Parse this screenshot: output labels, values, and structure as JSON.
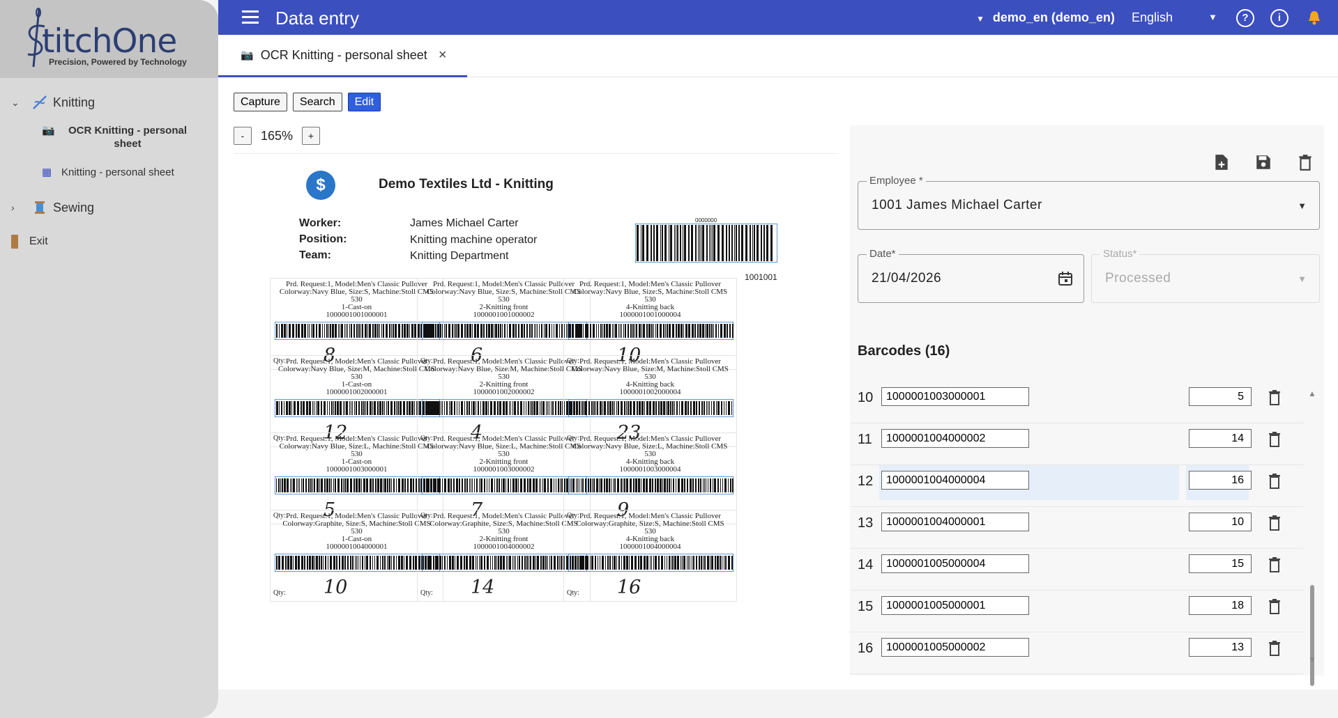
{
  "sidebar": {
    "logo_text": "titchOne",
    "logo_tag": "Precision, Powered by Technology",
    "groups": [
      {
        "label": "Knitting",
        "items": [
          {
            "label": "OCR Knitting - personal sheet"
          },
          {
            "label": "Knitting - personal sheet"
          }
        ]
      },
      {
        "label": "Sewing"
      }
    ],
    "exit_label": "Exit"
  },
  "header": {
    "title": "Data entry",
    "tenant": "demo_en (demo_en)",
    "language": "English",
    "help_glyph": "?",
    "info_glyph": "i"
  },
  "tab": {
    "label": "OCR Knitting - personal sheet",
    "close": "×"
  },
  "toolbar": {
    "capture": "Capture",
    "search": "Search",
    "edit": "Edit"
  },
  "zoom": {
    "minus": "-",
    "value": "165%",
    "plus": "+"
  },
  "document": {
    "title": "Demo Textiles Ltd - Knitting",
    "worker_label": "Worker:",
    "worker": "James Michael Carter",
    "position_label": "Position:",
    "position": "Knitting machine operator",
    "team_label": "Team:",
    "team": "Knitting Department",
    "barcode_number": "1001001",
    "barcode_top": "0000000",
    "qty_label": "Qty:",
    "cells": [
      {
        "l1": "Prd. Request:1, Model:Men's Classic Pullover",
        "l2": "Colorway:Navy Blue, Size:S, Machine:Stoll CMS",
        "l3": "530",
        "l4": "1-Cast-on",
        "l5": "1000001001000001",
        "qty": "8"
      },
      {
        "l1": "Prd. Request:1, Model:Men's Classic Pullover",
        "l2": "Colorway:Navy Blue, Size:S, Machine:Stoll CMS",
        "l3": "530",
        "l4": "2-Knitting front",
        "l5": "1000001001000002",
        "qty": "6"
      },
      {
        "l1": "Prd. Request:1, Model:Men's Classic Pullover",
        "l2": "Colorway:Navy Blue, Size:S, Machine:Stoll CMS",
        "l3": "530",
        "l4": "4-Knitting back",
        "l5": "1000001001000004",
        "qty": "10"
      },
      {
        "l1": "Prd. Request:1, Model:Men's Classic Pullover",
        "l2": "Colorway:Navy Blue, Size:M, Machine:Stoll CMS",
        "l3": "530",
        "l4": "1-Cast-on",
        "l5": "1000001002000001",
        "qty": "12"
      },
      {
        "l1": "Prd. Request:1, Model:Men's Classic Pullover",
        "l2": "Colorway:Navy Blue, Size:M, Machine:Stoll CMS",
        "l3": "530",
        "l4": "2-Knitting front",
        "l5": "1000001002000002",
        "qty": "4"
      },
      {
        "l1": "Prd. Request:1, Model:Men's Classic Pullover",
        "l2": "Colorway:Navy Blue, Size:M, Machine:Stoll CMS",
        "l3": "530",
        "l4": "4-Knitting back",
        "l5": "1000001002000004",
        "qty": "23"
      },
      {
        "l1": "Prd. Request:1, Model:Men's Classic Pullover",
        "l2": "Colorway:Navy Blue, Size:L, Machine:Stoll CMS",
        "l3": "530",
        "l4": "1-Cast-on",
        "l5": "1000001003000001",
        "qty": "5"
      },
      {
        "l1": "Prd. Request:1, Model:Men's Classic Pullover",
        "l2": "Colorway:Navy Blue, Size:L, Machine:Stoll CMS",
        "l3": "530",
        "l4": "2-Knitting front",
        "l5": "1000001003000002",
        "qty": "7"
      },
      {
        "l1": "Prd. Request:1, Model:Men's Classic Pullover",
        "l2": "Colorway:Navy Blue, Size:L, Machine:Stoll CMS",
        "l3": "530",
        "l4": "4-Knitting back",
        "l5": "1000001003000004",
        "qty": "9"
      },
      {
        "l1": "Prd. Request:1, Model:Men's Classic Pullover",
        "l2": "Colorway:Graphite, Size:S, Machine:Stoll CMS",
        "l3": "530",
        "l4": "1-Cast-on",
        "l5": "1000001004000001",
        "qty": "10"
      },
      {
        "l1": "Prd. Request:1, Model:Men's Classic Pullover",
        "l2": "Colorway:Graphite, Size:S, Machine:Stoll CMS",
        "l3": "530",
        "l4": "2-Knitting front",
        "l5": "1000001004000002",
        "qty": "14"
      },
      {
        "l1": "Prd. Request:1, Model:Men's Classic Pullover",
        "l2": "Colorway:Graphite, Size:S, Machine:Stoll CMS",
        "l3": "530",
        "l4": "4-Knitting back",
        "l5": "1000001004000004",
        "qty": "16"
      }
    ]
  },
  "form": {
    "employee_label": "Employee *",
    "employee_value": "1001 James Michael Carter",
    "date_label": "Date*",
    "date_value": "21/04/2026",
    "status_label": "Status*",
    "status_value": "Processed",
    "barcodes_title": "Barcodes (16)",
    "barcodes": [
      {
        "n": "10",
        "code": "1000001003000001",
        "qty": "5"
      },
      {
        "n": "11",
        "code": "1000001004000002",
        "qty": "14"
      },
      {
        "n": "12",
        "code": "1000001004000004",
        "qty": "16",
        "selected": true
      },
      {
        "n": "13",
        "code": "1000001004000001",
        "qty": "10"
      },
      {
        "n": "14",
        "code": "1000001005000004",
        "qty": "15"
      },
      {
        "n": "15",
        "code": "1000001005000001",
        "qty": "18"
      },
      {
        "n": "16",
        "code": "1000001005000002",
        "qty": "13"
      }
    ]
  },
  "colors": {
    "accent": "#3c4fbf",
    "edit_button": "#2f5fe0",
    "sidebar": "#d9d9d9",
    "selection": "#e6eef9"
  }
}
